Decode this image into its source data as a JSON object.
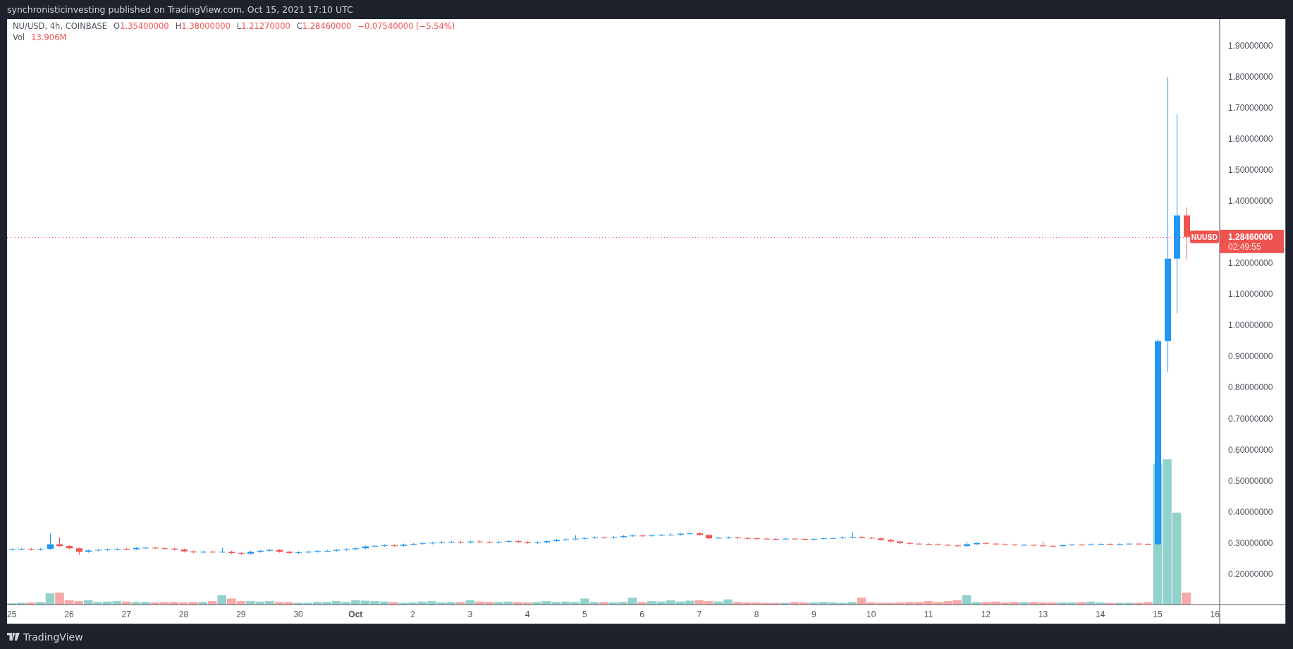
{
  "header": {
    "text": "synchronisticinvesting published on TradingView.com, Oct 15, 2021 17:10 UTC"
  },
  "legend": {
    "symbol": "NU/USD, 4h, COINBASE",
    "fields": [
      {
        "key": "O",
        "value": "1.35400000"
      },
      {
        "key": "H",
        "value": "1.38000000"
      },
      {
        "key": "L",
        "value": "1.21270000"
      },
      {
        "key": "C",
        "value": "1.28460000"
      }
    ],
    "change": "−0.07540000 (−5.54%)",
    "volume_label": "Vol",
    "volume_value": "13.906M"
  },
  "chart": {
    "symbol_badge": "NUUSD",
    "last_price": "1.28460000",
    "countdown": "02:49:55",
    "chart_data": {
      "type": "candlestick",
      "ylim": [
        0.102,
        1.986
      ],
      "ref_lines": [
        {
          "axis": "y",
          "value": 1.285
        }
      ],
      "categories": [
        "25",
        null,
        null,
        null,
        null,
        null,
        "26",
        null,
        null,
        null,
        null,
        null,
        "27",
        null,
        null,
        null,
        null,
        null,
        "28",
        null,
        null,
        null,
        null,
        null,
        "29",
        null,
        null,
        null,
        null,
        null,
        "30",
        null,
        null,
        null,
        null,
        null,
        "Oct",
        null,
        null,
        null,
        null,
        null,
        "2",
        null,
        null,
        null,
        null,
        null,
        "3",
        null,
        null,
        null,
        null,
        null,
        "4",
        null,
        null,
        null,
        null,
        null,
        "5",
        null,
        null,
        null,
        null,
        null,
        "6",
        null,
        null,
        null,
        null,
        null,
        "7",
        null,
        null,
        null,
        null,
        null,
        "8",
        null,
        null,
        null,
        null,
        null,
        "9",
        null,
        null,
        null,
        null,
        null,
        "10",
        null,
        null,
        null,
        null,
        null,
        "11",
        null,
        null,
        null,
        null,
        null,
        "12",
        null,
        null,
        null,
        null,
        null,
        "13",
        null,
        null,
        null,
        null,
        null,
        "14",
        null,
        null,
        null,
        null,
        null,
        "15",
        null,
        null,
        null,
        null,
        null,
        "16"
      ],
      "yticks": [
        {
          "value": 1.9,
          "label": "1.90000000"
        },
        {
          "value": 1.8,
          "label": "1.80000000"
        },
        {
          "value": 1.7,
          "label": "1.70000000"
        },
        {
          "value": 1.6,
          "label": "1.60000000"
        },
        {
          "value": 1.5,
          "label": "1.50000000"
        },
        {
          "value": 1.4,
          "label": "1.40000000"
        },
        {
          "value": 1.2,
          "label": "1.20000000"
        },
        {
          "value": 1.1,
          "label": "1.10000000"
        },
        {
          "value": 1.0,
          "label": "1.00000000"
        },
        {
          "value": 0.9,
          "label": "0.90000000"
        },
        {
          "value": 0.8,
          "label": "0.80000000"
        },
        {
          "value": 0.7,
          "label": "0.70000000"
        },
        {
          "value": 0.6,
          "label": "0.60000000"
        },
        {
          "value": 0.5,
          "label": "0.50000000"
        },
        {
          "value": 0.4,
          "label": "0.40000000"
        },
        {
          "value": 0.3,
          "label": "0.30000000"
        },
        {
          "value": 0.2,
          "label": "0.20000000"
        }
      ],
      "ohlc": [
        [
          0.279,
          0.283,
          0.276,
          0.28
        ],
        [
          0.28,
          0.284,
          0.277,
          0.281
        ],
        [
          0.281,
          0.284,
          0.276,
          0.279
        ],
        [
          0.279,
          0.284,
          0.276,
          0.281
        ],
        [
          0.281,
          0.33,
          0.278,
          0.296
        ],
        [
          0.296,
          0.318,
          0.287,
          0.29
        ],
        [
          0.29,
          0.293,
          0.28,
          0.283
        ],
        [
          0.283,
          0.286,
          0.262,
          0.272
        ],
        [
          0.272,
          0.279,
          0.269,
          0.276
        ],
        [
          0.276,
          0.281,
          0.273,
          0.278
        ],
        [
          0.278,
          0.282,
          0.275,
          0.279
        ],
        [
          0.279,
          0.284,
          0.276,
          0.281
        ],
        [
          0.281,
          0.284,
          0.277,
          0.28
        ],
        [
          0.28,
          0.287,
          0.277,
          0.284
        ],
        [
          0.284,
          0.288,
          0.281,
          0.285
        ],
        [
          0.285,
          0.288,
          0.28,
          0.283
        ],
        [
          0.283,
          0.286,
          0.279,
          0.282
        ],
        [
          0.282,
          0.285,
          0.276,
          0.279
        ],
        [
          0.279,
          0.282,
          0.27,
          0.273
        ],
        [
          0.273,
          0.276,
          0.267,
          0.27
        ],
        [
          0.27,
          0.275,
          0.267,
          0.272
        ],
        [
          0.272,
          0.275,
          0.268,
          0.271
        ],
        [
          0.271,
          0.285,
          0.268,
          0.272
        ],
        [
          0.272,
          0.275,
          0.265,
          0.268
        ],
        [
          0.268,
          0.271,
          0.262,
          0.266
        ],
        [
          0.266,
          0.275,
          0.263,
          0.272
        ],
        [
          0.272,
          0.278,
          0.269,
          0.275
        ],
        [
          0.275,
          0.281,
          0.272,
          0.278
        ],
        [
          0.278,
          0.281,
          0.269,
          0.272
        ],
        [
          0.272,
          0.275,
          0.265,
          0.268
        ],
        [
          0.268,
          0.273,
          0.265,
          0.27
        ],
        [
          0.27,
          0.275,
          0.267,
          0.272
        ],
        [
          0.272,
          0.277,
          0.269,
          0.274
        ],
        [
          0.274,
          0.278,
          0.271,
          0.275
        ],
        [
          0.275,
          0.281,
          0.272,
          0.278
        ],
        [
          0.278,
          0.283,
          0.275,
          0.28
        ],
        [
          0.28,
          0.286,
          0.277,
          0.283
        ],
        [
          0.283,
          0.292,
          0.28,
          0.289
        ],
        [
          0.289,
          0.294,
          0.286,
          0.291
        ],
        [
          0.291,
          0.296,
          0.288,
          0.293
        ],
        [
          0.293,
          0.296,
          0.288,
          0.291
        ],
        [
          0.291,
          0.298,
          0.288,
          0.295
        ],
        [
          0.295,
          0.3,
          0.292,
          0.297
        ],
        [
          0.297,
          0.302,
          0.294,
          0.299
        ],
        [
          0.299,
          0.304,
          0.296,
          0.301
        ],
        [
          0.301,
          0.306,
          0.298,
          0.303
        ],
        [
          0.303,
          0.307,
          0.3,
          0.304
        ],
        [
          0.304,
          0.307,
          0.299,
          0.302
        ],
        [
          0.302,
          0.308,
          0.299,
          0.305
        ],
        [
          0.305,
          0.308,
          0.3,
          0.303
        ],
        [
          0.303,
          0.306,
          0.299,
          0.302
        ],
        [
          0.302,
          0.307,
          0.299,
          0.304
        ],
        [
          0.304,
          0.309,
          0.301,
          0.306
        ],
        [
          0.306,
          0.309,
          0.3,
          0.303
        ],
        [
          0.303,
          0.306,
          0.297,
          0.3
        ],
        [
          0.3,
          0.305,
          0.297,
          0.302
        ],
        [
          0.302,
          0.309,
          0.299,
          0.306
        ],
        [
          0.306,
          0.313,
          0.303,
          0.31
        ],
        [
          0.31,
          0.315,
          0.307,
          0.312
        ],
        [
          0.312,
          0.325,
          0.309,
          0.314
        ],
        [
          0.314,
          0.319,
          0.311,
          0.316
        ],
        [
          0.316,
          0.321,
          0.313,
          0.318
        ],
        [
          0.318,
          0.321,
          0.314,
          0.317
        ],
        [
          0.317,
          0.322,
          0.314,
          0.319
        ],
        [
          0.319,
          0.325,
          0.316,
          0.322
        ],
        [
          0.322,
          0.327,
          0.319,
          0.324
        ],
        [
          0.324,
          0.327,
          0.32,
          0.323
        ],
        [
          0.323,
          0.328,
          0.32,
          0.325
        ],
        [
          0.325,
          0.329,
          0.322,
          0.326
        ],
        [
          0.326,
          0.333,
          0.323,
          0.327
        ],
        [
          0.327,
          0.333,
          0.324,
          0.33
        ],
        [
          0.33,
          0.334,
          0.327,
          0.331
        ],
        [
          0.331,
          0.336,
          0.323,
          0.326
        ],
        [
          0.326,
          0.329,
          0.312,
          0.315
        ],
        [
          0.315,
          0.32,
          0.312,
          0.317
        ],
        [
          0.317,
          0.321,
          0.314,
          0.318
        ],
        [
          0.318,
          0.321,
          0.313,
          0.316
        ],
        [
          0.316,
          0.319,
          0.312,
          0.315
        ],
        [
          0.315,
          0.318,
          0.311,
          0.314
        ],
        [
          0.314,
          0.317,
          0.31,
          0.313
        ],
        [
          0.313,
          0.316,
          0.309,
          0.312
        ],
        [
          0.312,
          0.317,
          0.309,
          0.314
        ],
        [
          0.314,
          0.317,
          0.31,
          0.313
        ],
        [
          0.313,
          0.316,
          0.309,
          0.312
        ],
        [
          0.312,
          0.316,
          0.309,
          0.313
        ],
        [
          0.313,
          0.318,
          0.31,
          0.315
        ],
        [
          0.315,
          0.319,
          0.312,
          0.316
        ],
        [
          0.316,
          0.321,
          0.313,
          0.318
        ],
        [
          0.318,
          0.335,
          0.315,
          0.32
        ],
        [
          0.32,
          0.323,
          0.314,
          0.317
        ],
        [
          0.317,
          0.32,
          0.312,
          0.315
        ],
        [
          0.315,
          0.318,
          0.307,
          0.31
        ],
        [
          0.31,
          0.313,
          0.302,
          0.305
        ],
        [
          0.305,
          0.308,
          0.297,
          0.3
        ],
        [
          0.3,
          0.303,
          0.295,
          0.298
        ],
        [
          0.298,
          0.301,
          0.294,
          0.297
        ],
        [
          0.297,
          0.3,
          0.293,
          0.296
        ],
        [
          0.296,
          0.299,
          0.291,
          0.294
        ],
        [
          0.294,
          0.297,
          0.289,
          0.292
        ],
        [
          0.292,
          0.295,
          0.287,
          0.29
        ],
        [
          0.29,
          0.305,
          0.287,
          0.296
        ],
        [
          0.296,
          0.303,
          0.293,
          0.3
        ],
        [
          0.3,
          0.303,
          0.295,
          0.298
        ],
        [
          0.298,
          0.301,
          0.293,
          0.296
        ],
        [
          0.296,
          0.299,
          0.292,
          0.295
        ],
        [
          0.295,
          0.298,
          0.29,
          0.293
        ],
        [
          0.293,
          0.297,
          0.29,
          0.294
        ],
        [
          0.294,
          0.297,
          0.289,
          0.292
        ],
        [
          0.292,
          0.305,
          0.288,
          0.291
        ],
        [
          0.291,
          0.294,
          0.287,
          0.29
        ],
        [
          0.29,
          0.296,
          0.287,
          0.293
        ],
        [
          0.293,
          0.298,
          0.29,
          0.295
        ],
        [
          0.295,
          0.298,
          0.291,
          0.294
        ],
        [
          0.294,
          0.299,
          0.291,
          0.296
        ],
        [
          0.296,
          0.3,
          0.293,
          0.297
        ],
        [
          0.297,
          0.3,
          0.293,
          0.296
        ],
        [
          0.296,
          0.3,
          0.293,
          0.297
        ],
        [
          0.297,
          0.301,
          0.294,
          0.298
        ],
        [
          0.298,
          0.301,
          0.294,
          0.297
        ],
        [
          0.297,
          0.3,
          0.293,
          0.296
        ],
        [
          0.296,
          0.955,
          0.29,
          0.95
        ],
        [
          0.95,
          1.8,
          0.85,
          1.215
        ],
        [
          1.215,
          1.68,
          1.04,
          1.354
        ],
        [
          1.354,
          1.38,
          1.213,
          1.285
        ],
        null,
        null,
        null
      ]
    }
  },
  "footer": {
    "logo_text": "TradingView"
  }
}
